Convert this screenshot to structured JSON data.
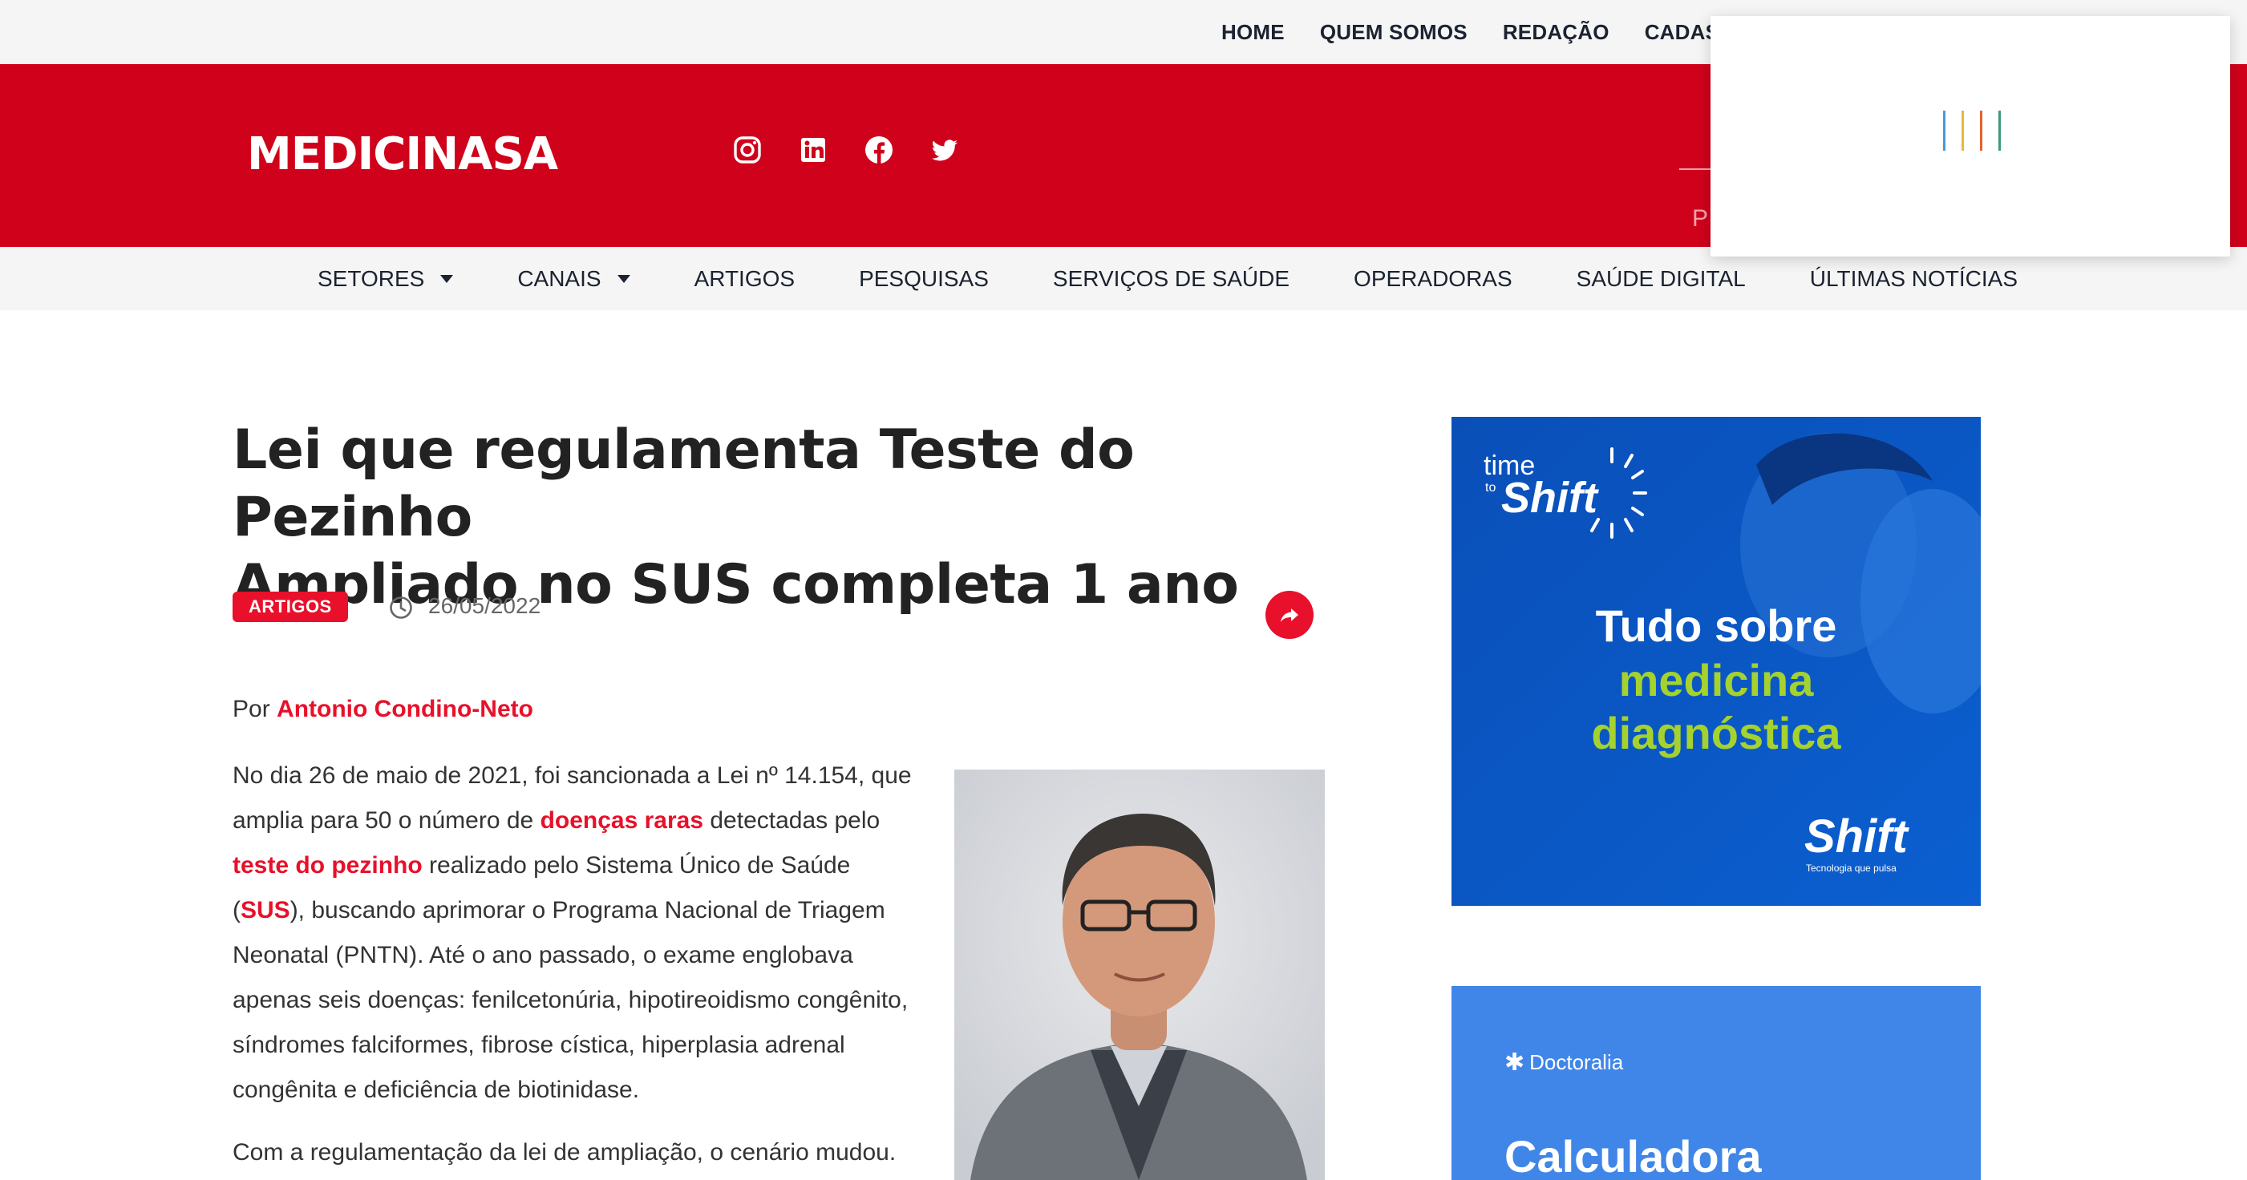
{
  "top_nav": [
    "HOME",
    "QUEM SOMOS",
    "REDAÇÃO",
    "CADASTR"
  ],
  "brand": {
    "logo_text": "MEDICINASA",
    "primary_color": "#d0021b",
    "accent_color": "#e8102a"
  },
  "socials": [
    "instagram-icon",
    "linkedin-icon",
    "facebook-icon",
    "twitter-icon"
  ],
  "search": {
    "placeholder": "P"
  },
  "main_nav": {
    "items": [
      {
        "label": "SETORES",
        "dropdown": true
      },
      {
        "label": "CANAIS",
        "dropdown": true
      },
      {
        "label": "ARTIGOS"
      },
      {
        "label": "PESQUISAS"
      },
      {
        "label": "SERVIÇOS DE SAÚDE"
      },
      {
        "label": "OPERADORAS"
      },
      {
        "label": "SAÚDE DIGITAL"
      },
      {
        "label": "ÚLTIMAS NOTÍCIAS"
      }
    ]
  },
  "article": {
    "title_line1": "Lei que regulamenta Teste do Pezinho",
    "title_line2": "Ampliado no SUS completa 1 ano",
    "category": "ARTIGOS",
    "date": "26/05/2022",
    "byline_prefix": "Por ",
    "author": "Antonio Condino-Neto",
    "p1": {
      "t1": "No dia 26 de maio de 2021, foi sancionada a Lei nº 14.154, que amplia para 50 o número de ",
      "l1": "doenças raras",
      "t2": " detectadas pelo ",
      "l2": "teste do pezinho",
      "t3": " realizado pelo Sistema Único de Saúde (",
      "l3": "SUS",
      "t4": "), buscando aprimorar o Programa Nacional de Triagem Neonatal (PNTN). Até o ano passado, o exame englobava apenas seis doenças: fenilcetonúria, hipotireoidismo congênito, síndromes falciformes, fibrose cística, hiperplasia adrenal congênita e deficiência de biotinidase."
    },
    "p2": "Com a regulamentação da lei de ampliação, o cenário mudou."
  },
  "ads": {
    "ad1": {
      "brand_top_small": "time",
      "brand_top_small2": "to",
      "brand_top": "Shift",
      "headline1": "Tudo sobre",
      "headline2": "medicina",
      "headline3": "diagnóstica",
      "brand_bottom": "Shift",
      "tagline": "Tecnologia que pulsa"
    },
    "ad2": {
      "brand": "Doctoralia",
      "headline": "Calculadora"
    }
  },
  "popup": {
    "loader_colors": [
      "#4a7dd6",
      "#e8b93a",
      "#e2612e",
      "#3a9a5a"
    ]
  }
}
